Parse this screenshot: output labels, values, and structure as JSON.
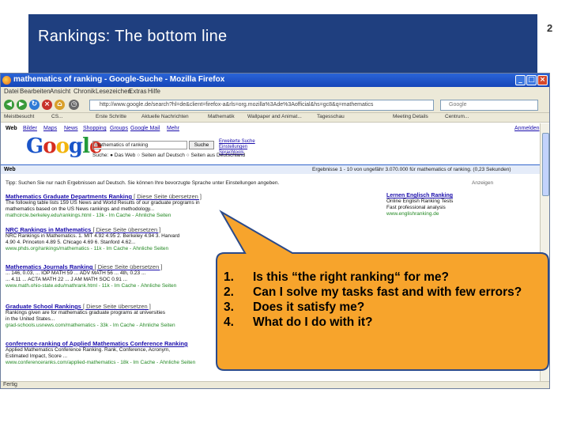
{
  "slide": {
    "title": "Rankings: The bottom line",
    "page_number": "2"
  },
  "browser": {
    "window_title": "mathematics of ranking - Google-Suche - Mozilla Firefox",
    "menu": [
      "Datei",
      "Bearbeiten",
      "Ansicht",
      "Chronik",
      "Lesezeichen",
      "Extras",
      "Hilfe"
    ],
    "url": "http://www.google.de/search?hl=de&client=firefox-a&rls=org.mozilla%3Ade%3Aofficial&hs=gc8&q=mathematics",
    "search_box": "Google",
    "bookmarks": [
      "Meistbesucht",
      "CS...",
      "Erste Schritte",
      "Aktuelle Nachrichten",
      "Mathematik",
      "Wallpaper and Animat...",
      "Tagesschau",
      "Meeting Details",
      "Centrum..."
    ],
    "status": "Fertig"
  },
  "google": {
    "tabs": [
      "Web",
      "Bilder",
      "Maps",
      "News",
      "Shopping",
      "Groups",
      "Google Mail",
      "Mehr"
    ],
    "active_tab": "Web",
    "top_right_link": "Anmelden",
    "logo": [
      "G",
      "o",
      "o",
      "g",
      "l",
      "e"
    ],
    "query": "mathematics of ranking",
    "search_button": "Suche",
    "side_links": [
      "Erweiterte Suche",
      "Einstellungen",
      "Sprachtools"
    ],
    "radio_label": "Suche:",
    "radio_options": [
      "Das Web",
      "Seiten auf Deutsch",
      "Seiten aus Deutschland"
    ],
    "web_label": "Web",
    "results_stats": "Ergebnisse 1 - 10 von ungefähr 3.070.000 für mathematics of ranking. (0,23 Sekunden)",
    "tip": "Tipp: Suchen Sie nur nach Ergebnissen auf Deutsch. Sie können Ihre bevorzugte Sprache unter Einstellungen angeben.",
    "ads_label": "Anzeigen",
    "results": [
      {
        "title": "Mathematics Graduate Departments Ranking",
        "cache": "[ Diese Seite übersetzen ]",
        "snippet": [
          "The following table lists 159 US News and World Results of our graduate programs in",
          "mathematics based on the US News rankings and methodology..."
        ],
        "url": "mathcircle.berkeley.edu/rankings.html - 13k - Im Cache - Ähnliche Seiten"
      },
      {
        "title": "NRC Rankings in Mathematics",
        "cache": "[ Diese Seite übersetzen ]",
        "snippet": [
          "NRC Rankings in Mathematics. 1. MIT 4.92 4.95 2. Berkeley 4.94 3. Harvard",
          "4.90 4. Princeton 4.89 5. Chicago 4.69 6. Stanford 4.62..."
        ],
        "url": "www.phds.org/rankings/mathematics - 11k - Im Cache - Ähnliche Seiten"
      },
      {
        "title": "Mathematics Journals Ranking",
        "cache": "[ Diese Seite übersetzen ]",
        "snippet": [
          "... 146, 0.03, ... IOP MATH 59 ... ADV MATH 56 ... 4th, 0.23 ...",
          "... 4.11 ... ACTA MATH 22 ... J AM MATH SOC 0.91 ..."
        ],
        "url": "www.math.ohio-state.edu/mathrank.html - 11k - Im Cache - Ähnliche Seiten"
      },
      {
        "title": "Graduate School Rankings",
        "cache": "[ Diese Seite übersetzen ]",
        "snippet": [
          "Rankings given are for mathematics graduate programs at universities",
          "in the United States..."
        ],
        "url": "grad-schools.usnews.com/mathematics - 33k - Im Cache - Ähnliche Seiten"
      },
      {
        "title": "conference-ranking of Applied Mathematics Conference Ranking",
        "cache": "",
        "snippet": [
          "Applied Mathematics Conference Ranking. Rank, Conference, Acronym,",
          "Estimated Impact, Score ..."
        ],
        "url": "www.conferenceranks.com/applied-mathematics - 18k - Im Cache - Ähnliche Seiten"
      }
    ],
    "ads": [
      {
        "title": "Lernen Englisch Ranking",
        "lines": [
          "Online English Ranking Tests",
          "Fast professional analysis"
        ],
        "url": "www.englishranking.de"
      }
    ]
  },
  "callout": {
    "fill": "#f7a42c",
    "items": [
      {
        "n": "1.",
        "text": "Is this “the right ranking“ for me?"
      },
      {
        "n": "2.",
        "text": "Can I solve my tasks fast and with few errors?"
      },
      {
        "n": "3.",
        "text": "Does it satisfy me?"
      },
      {
        "n": "4.",
        "text": "What do I do with it?"
      }
    ]
  }
}
